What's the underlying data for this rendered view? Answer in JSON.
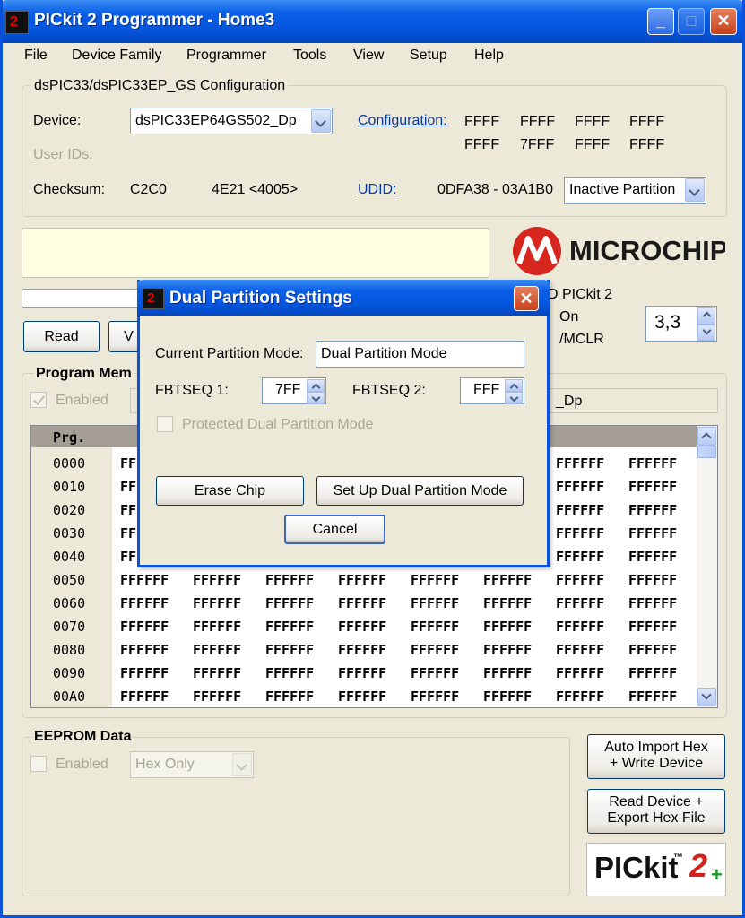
{
  "window": {
    "title": "PICkit 2 Programmer - Home3",
    "accent": "#0a52d9"
  },
  "menu": [
    "File",
    "Device Family",
    "Programmer",
    "Tools",
    "View",
    "Setup",
    "Help"
  ],
  "config": {
    "group_title": "dsPIC33/dsPIC33EP_GS Configuration",
    "device_label": "Device:",
    "device_value": "dsPIC33EP64GS502_Dp",
    "configuration_link": "Configuration:",
    "config_words": [
      "FFFF",
      "FFFF",
      "FFFF",
      "FFFF",
      "FFFF",
      "7FFF",
      "FFFF",
      "FFFF"
    ],
    "user_ids_link": "User IDs:",
    "checksum_label": "Checksum:",
    "checksum_value": "C2C0",
    "checksum_extra": "4E21 <4005>",
    "udid_link": "UDID:",
    "udid_value": "0DFA38 - 03A1B0",
    "partition_value": "Inactive Partition"
  },
  "controls": {
    "read_label": "Read",
    "v_label": "V",
    "vdd_partial": "D PICkit 2",
    "on_label": "On",
    "mclr_label": "/MCLR",
    "voltage": "3,3"
  },
  "program_memory": {
    "title": "Program Mem",
    "enabled_label": "Enabled",
    "source_partial": "_Dp",
    "header": "Prg.",
    "rows": [
      {
        "addr": "0000",
        "words": [
          "FF",
          "",
          "",
          "",
          "",
          "",
          "FFFFFF",
          "FFFFFF"
        ]
      },
      {
        "addr": "0010",
        "words": [
          "FF",
          "",
          "",
          "",
          "",
          "",
          "FFFFFF",
          "FFFFFF"
        ]
      },
      {
        "addr": "0020",
        "words": [
          "FF",
          "",
          "",
          "",
          "",
          "",
          "FFFFFF",
          "FFFFFF"
        ]
      },
      {
        "addr": "0030",
        "words": [
          "FF",
          "",
          "",
          "",
          "",
          "",
          "FFFFFF",
          "FFFFFF"
        ]
      },
      {
        "addr": "0040",
        "words": [
          "FF",
          "",
          "",
          "",
          "",
          "",
          "FFFFFF",
          "FFFFFF"
        ]
      },
      {
        "addr": "0050",
        "words": [
          "FFFFFF",
          "FFFFFF",
          "FFFFFF",
          "FFFFFF",
          "FFFFFF",
          "FFFFFF",
          "FFFFFF",
          "FFFFFF"
        ]
      },
      {
        "addr": "0060",
        "words": [
          "FFFFFF",
          "FFFFFF",
          "FFFFFF",
          "FFFFFF",
          "FFFFFF",
          "FFFFFF",
          "FFFFFF",
          "FFFFFF"
        ]
      },
      {
        "addr": "0070",
        "words": [
          "FFFFFF",
          "FFFFFF",
          "FFFFFF",
          "FFFFFF",
          "FFFFFF",
          "FFFFFF",
          "FFFFFF",
          "FFFFFF"
        ]
      },
      {
        "addr": "0080",
        "words": [
          "FFFFFF",
          "FFFFFF",
          "FFFFFF",
          "FFFFFF",
          "FFFFFF",
          "FFFFFF",
          "FFFFFF",
          "FFFFFF"
        ]
      },
      {
        "addr": "0090",
        "words": [
          "FFFFFF",
          "FFFFFF",
          "FFFFFF",
          "FFFFFF",
          "FFFFFF",
          "FFFFFF",
          "FFFFFF",
          "FFFFFF"
        ]
      },
      {
        "addr": "00A0",
        "words": [
          "FFFFFF",
          "FFFFFF",
          "FFFFFF",
          "FFFFFF",
          "FFFFFF",
          "FFFFFF",
          "FFFFFF",
          "FFFFFF"
        ]
      }
    ]
  },
  "eeprom": {
    "title": "EEPROM Data",
    "enabled_label": "Enabled",
    "mode_value": "Hex Only"
  },
  "side_buttons": {
    "auto_import_line1": "Auto Import Hex",
    "auto_import_line2": "+ Write Device",
    "read_export_line1": "Read Device +",
    "read_export_line2": "Export Hex File"
  },
  "logos": {
    "microchip": "MICROCHIP",
    "pickit": "PICkit",
    "pickit_tm": "™",
    "pickit_two": "2",
    "pickit_plus": "+"
  },
  "dialog": {
    "title": "Dual Partition Settings",
    "mode_label": "Current Partition Mode:",
    "mode_value": "Dual Partition Mode",
    "fbtseq1_label": "FBTSEQ 1:",
    "fbtseq1_value": "7FF",
    "fbtseq2_label": "FBTSEQ 2:",
    "fbtseq2_value": "FFF",
    "protected_label": "Protected Dual Partition Mode",
    "erase_label": "Erase Chip",
    "setup_label": "Set Up Dual Partition Mode",
    "cancel_label": "Cancel"
  }
}
